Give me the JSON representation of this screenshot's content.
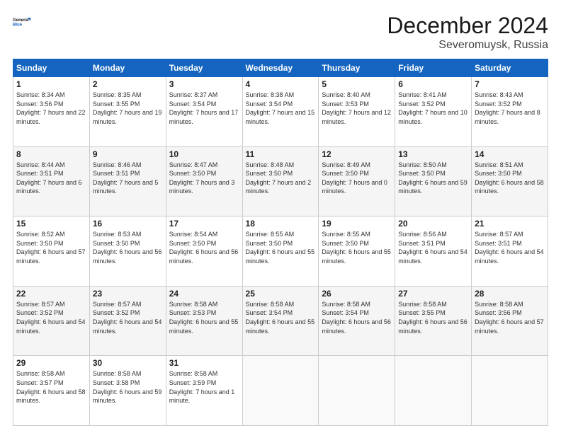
{
  "logo": {
    "line1": "General",
    "line2": "Blue"
  },
  "header": {
    "title": "December 2024",
    "subtitle": "Severomuysk, Russia"
  },
  "weekdays": [
    "Sunday",
    "Monday",
    "Tuesday",
    "Wednesday",
    "Thursday",
    "Friday",
    "Saturday"
  ],
  "weeks": [
    [
      {
        "day": "1",
        "sunrise": "8:34 AM",
        "sunset": "3:56 PM",
        "daylight": "7 hours and 22 minutes."
      },
      {
        "day": "2",
        "sunrise": "8:35 AM",
        "sunset": "3:55 PM",
        "daylight": "7 hours and 19 minutes."
      },
      {
        "day": "3",
        "sunrise": "8:37 AM",
        "sunset": "3:54 PM",
        "daylight": "7 hours and 17 minutes."
      },
      {
        "day": "4",
        "sunrise": "8:38 AM",
        "sunset": "3:54 PM",
        "daylight": "7 hours and 15 minutes."
      },
      {
        "day": "5",
        "sunrise": "8:40 AM",
        "sunset": "3:53 PM",
        "daylight": "7 hours and 12 minutes."
      },
      {
        "day": "6",
        "sunrise": "8:41 AM",
        "sunset": "3:52 PM",
        "daylight": "7 hours and 10 minutes."
      },
      {
        "day": "7",
        "sunrise": "8:43 AM",
        "sunset": "3:52 PM",
        "daylight": "7 hours and 8 minutes."
      }
    ],
    [
      {
        "day": "8",
        "sunrise": "8:44 AM",
        "sunset": "3:51 PM",
        "daylight": "7 hours and 6 minutes."
      },
      {
        "day": "9",
        "sunrise": "8:46 AM",
        "sunset": "3:51 PM",
        "daylight": "7 hours and 5 minutes."
      },
      {
        "day": "10",
        "sunrise": "8:47 AM",
        "sunset": "3:50 PM",
        "daylight": "7 hours and 3 minutes."
      },
      {
        "day": "11",
        "sunrise": "8:48 AM",
        "sunset": "3:50 PM",
        "daylight": "7 hours and 2 minutes."
      },
      {
        "day": "12",
        "sunrise": "8:49 AM",
        "sunset": "3:50 PM",
        "daylight": "7 hours and 0 minutes."
      },
      {
        "day": "13",
        "sunrise": "8:50 AM",
        "sunset": "3:50 PM",
        "daylight": "6 hours and 59 minutes."
      },
      {
        "day": "14",
        "sunrise": "8:51 AM",
        "sunset": "3:50 PM",
        "daylight": "6 hours and 58 minutes."
      }
    ],
    [
      {
        "day": "15",
        "sunrise": "8:52 AM",
        "sunset": "3:50 PM",
        "daylight": "6 hours and 57 minutes."
      },
      {
        "day": "16",
        "sunrise": "8:53 AM",
        "sunset": "3:50 PM",
        "daylight": "6 hours and 56 minutes."
      },
      {
        "day": "17",
        "sunrise": "8:54 AM",
        "sunset": "3:50 PM",
        "daylight": "6 hours and 56 minutes."
      },
      {
        "day": "18",
        "sunrise": "8:55 AM",
        "sunset": "3:50 PM",
        "daylight": "6 hours and 55 minutes."
      },
      {
        "day": "19",
        "sunrise": "8:55 AM",
        "sunset": "3:50 PM",
        "daylight": "6 hours and 55 minutes."
      },
      {
        "day": "20",
        "sunrise": "8:56 AM",
        "sunset": "3:51 PM",
        "daylight": "6 hours and 54 minutes."
      },
      {
        "day": "21",
        "sunrise": "8:57 AM",
        "sunset": "3:51 PM",
        "daylight": "6 hours and 54 minutes."
      }
    ],
    [
      {
        "day": "22",
        "sunrise": "8:57 AM",
        "sunset": "3:52 PM",
        "daylight": "6 hours and 54 minutes."
      },
      {
        "day": "23",
        "sunrise": "8:57 AM",
        "sunset": "3:52 PM",
        "daylight": "6 hours and 54 minutes."
      },
      {
        "day": "24",
        "sunrise": "8:58 AM",
        "sunset": "3:53 PM",
        "daylight": "6 hours and 55 minutes."
      },
      {
        "day": "25",
        "sunrise": "8:58 AM",
        "sunset": "3:54 PM",
        "daylight": "6 hours and 55 minutes."
      },
      {
        "day": "26",
        "sunrise": "8:58 AM",
        "sunset": "3:54 PM",
        "daylight": "6 hours and 56 minutes."
      },
      {
        "day": "27",
        "sunrise": "8:58 AM",
        "sunset": "3:55 PM",
        "daylight": "6 hours and 56 minutes."
      },
      {
        "day": "28",
        "sunrise": "8:58 AM",
        "sunset": "3:56 PM",
        "daylight": "6 hours and 57 minutes."
      }
    ],
    [
      {
        "day": "29",
        "sunrise": "8:58 AM",
        "sunset": "3:57 PM",
        "daylight": "6 hours and 58 minutes."
      },
      {
        "day": "30",
        "sunrise": "8:58 AM",
        "sunset": "3:58 PM",
        "daylight": "6 hours and 59 minutes."
      },
      {
        "day": "31",
        "sunrise": "8:58 AM",
        "sunset": "3:59 PM",
        "daylight": "7 hours and 1 minute."
      },
      null,
      null,
      null,
      null
    ]
  ]
}
